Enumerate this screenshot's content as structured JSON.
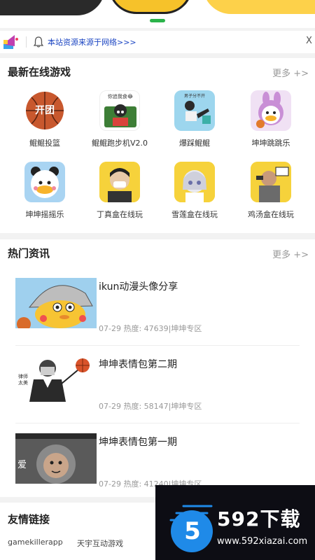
{
  "notice": {
    "text": "本站资源来源于网络>>>",
    "close": "X"
  },
  "games_section": {
    "title": "最新在线游戏",
    "more": "更多 +>",
    "games": [
      {
        "name": "鲲鲲投篮",
        "icon_label": "开团",
        "icon": "basketball-icon"
      },
      {
        "name": "鲲鲲跑步机V2.0",
        "icon_label": "你追我食😂",
        "icon": "treadmill-game-icon"
      },
      {
        "name": "爆踩鲲鲲",
        "icon_label": "男子分不开",
        "icon": "stomp-game-icon"
      },
      {
        "name": "坤坤跳跳乐",
        "icon_label": "",
        "icon": "chick-bunny-icon"
      },
      {
        "name": "坤坤摇摇乐",
        "icon_label": "",
        "icon": "chick-panda-icon"
      },
      {
        "name": "丁真盒在线玩",
        "icon_label": "",
        "icon": "dingzhen-box-icon"
      },
      {
        "name": "雪莲盒在线玩",
        "icon_label": "",
        "icon": "xuelian-box-icon"
      },
      {
        "name": "鸡汤盒在线玩",
        "icon_label": "",
        "icon": "chicken-soup-box-icon"
      }
    ]
  },
  "news_section": {
    "title": "热门资讯",
    "more": "更多 +>",
    "items": [
      {
        "title": "ikun动漫头像分享",
        "meta": "07-29  热度: 47639|坤坤专区"
      },
      {
        "title": "坤坤表情包第二期",
        "meta": "07-29  热度: 58147|坤坤专区",
        "thumb_caption": "律师太美"
      },
      {
        "title": "坤坤表情包第一期",
        "meta": "07-29  热度: 41240|坤坤专区",
        "thumb_caption": "爱"
      }
    ]
  },
  "links_section": {
    "title": "友情链接",
    "links": [
      "gamekillerapp",
      "天宇互动游戏"
    ]
  },
  "watermark": {
    "logo_digit": "5",
    "title": "592下载",
    "url": "www.592xiazai.com"
  },
  "colors": {
    "notice_text": "#1a44c2",
    "indicator": "#2bb34a",
    "accent_yellow": "#fdd14a"
  }
}
